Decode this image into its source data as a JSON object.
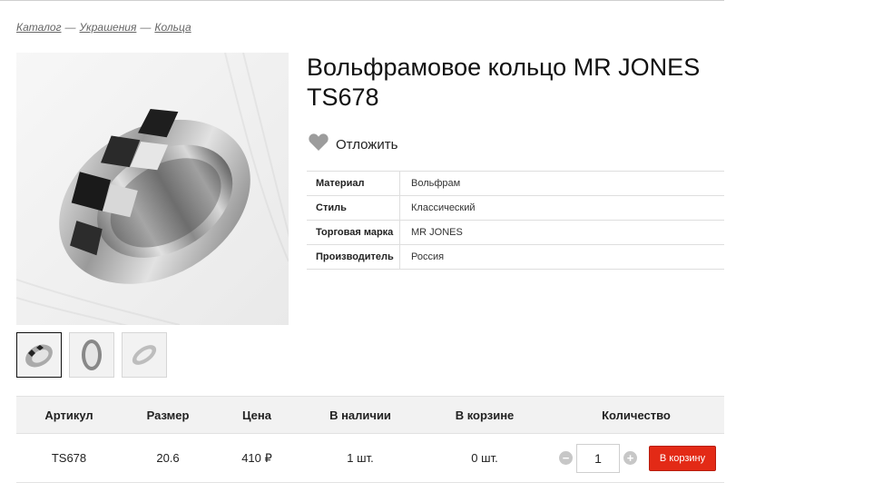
{
  "breadcrumbs": {
    "items": [
      "Каталог",
      "Украшения",
      "Кольца"
    ],
    "separator": "—"
  },
  "product": {
    "title": "Вольфрамовое кольцо MR JONES TS678",
    "wishlist_label": "Отложить",
    "icons": {
      "wishlist": "heart-icon"
    },
    "properties": [
      {
        "key": "Материал",
        "value": "Вольфрам"
      },
      {
        "key": "Стиль",
        "value": "Классический"
      },
      {
        "key": "Торговая марка",
        "value": "MR JONES"
      },
      {
        "key": "Производитель",
        "value": "Россия"
      }
    ]
  },
  "offers": {
    "headers": [
      "Артикул",
      "Размер",
      "Цена",
      "В наличии",
      "В корзине",
      "Количество"
    ],
    "rows": [
      {
        "sku": "TS678",
        "size": "20.6",
        "price": "410 ₽",
        "stock": "1 шт.",
        "in_cart": "0 шт.",
        "quantity": "1",
        "button": "В корзину"
      }
    ],
    "icons": {
      "decrement": "minus-circle-icon",
      "increment": "plus-circle-icon"
    }
  },
  "colors": {
    "accent": "#e32a16",
    "header_bg": "#f2f2f2",
    "icon_gray": "#c7c7c7"
  }
}
